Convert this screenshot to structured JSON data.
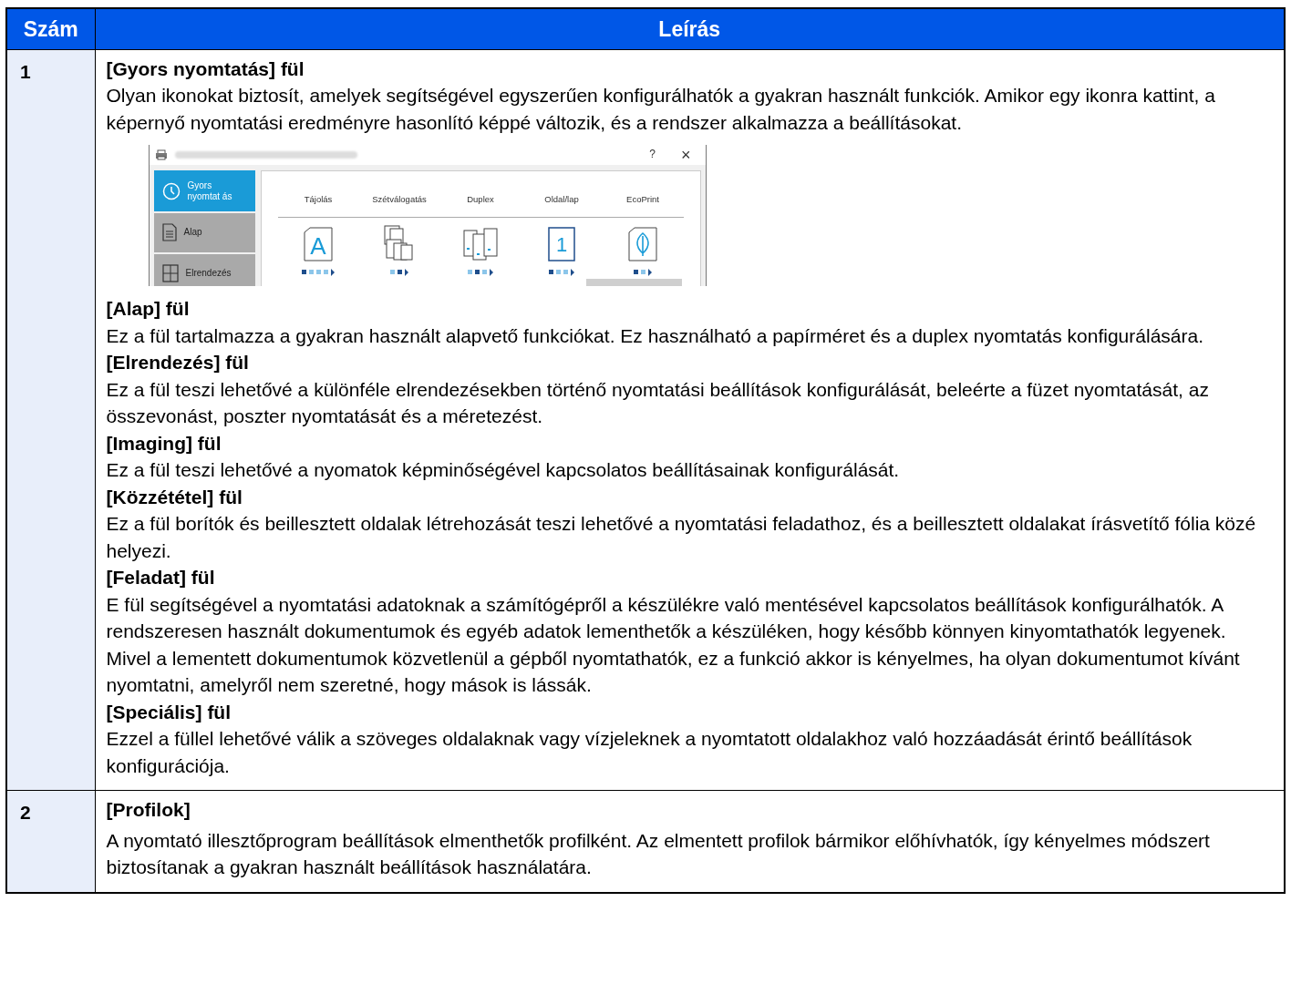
{
  "table": {
    "columns": [
      "Szám",
      "Leírás"
    ],
    "rows": [
      {
        "number": "1",
        "sections": [
          {
            "heading": "[Gyors nyomtatás] fül",
            "body": "Olyan ikonokat biztosít, amelyek segítségével egyszerűen konfigurálhatók a gyakran használt funkciók. Amikor egy ikonra kattint, a képernyő nyomtatási eredményre hasonlító képpé változik, és a rendszer alkalmazza a beállításokat.",
            "screenshot": {
              "help": "?",
              "close": "×",
              "tabs": [
                {
                  "label": "Gyors nyomtat ás",
                  "kind": "clock",
                  "selected": true
                },
                {
                  "label": "Alap",
                  "kind": "doc",
                  "selected": false
                },
                {
                  "label": "Elrendezés",
                  "kind": "grid",
                  "selected": false
                }
              ],
              "options": [
                {
                  "label": "Tájolás",
                  "kind": "letter",
                  "glyph": "A",
                  "dots": [
                    {
                      "selected": true
                    },
                    {
                      "selected": false
                    },
                    {
                      "selected": false
                    },
                    {
                      "selected": false
                    }
                  ]
                },
                {
                  "label": "Szétválogatás",
                  "kind": "collate",
                  "dots": [
                    {
                      "selected": false
                    },
                    {
                      "selected": true
                    }
                  ]
                },
                {
                  "label": "Duplex",
                  "kind": "duplex",
                  "dots": [
                    {
                      "selected": false
                    },
                    {
                      "selected": true
                    },
                    {
                      "selected": false
                    }
                  ]
                },
                {
                  "label": "Oldal/lap",
                  "kind": "page",
                  "glyph": "1",
                  "dots": [
                    {
                      "selected": true
                    },
                    {
                      "selected": false
                    },
                    {
                      "selected": false
                    }
                  ]
                },
                {
                  "label": "EcoPrint",
                  "kind": "leaf",
                  "dots": [
                    {
                      "selected": true
                    },
                    {
                      "selected": false
                    }
                  ]
                }
              ]
            }
          },
          {
            "heading": "[Alap] fül",
            "body": "Ez a fül tartalmazza a gyakran használt alapvető funkciókat. Ez használható a papírméret és a duplex nyomtatás konfigurálására."
          },
          {
            "heading": "[Elrendezés] fül",
            "body": "Ez a fül teszi lehetővé a különféle elrendezésekben történő nyomtatási beállítások konfigurálását, beleérte a füzet nyomtatását, az összevonást, poszter nyomtatását és a méretezést."
          },
          {
            "heading": "[Imaging] fül",
            "body": "Ez a fül teszi lehetővé a nyomatok képminőségével kapcsolatos beállításainak konfigurálását."
          },
          {
            "heading": "[Közzététel] fül",
            "body": "Ez a fül borítók és beillesztett oldalak létrehozását teszi lehetővé a nyomtatási feladathoz, és a beillesztett oldalakat írásvetítő fólia közé helyezi."
          },
          {
            "heading": "[Feladat] fül",
            "body": "E fül segítségével a nyomtatási adatoknak a számítógépről a készülékre való mentésével kapcsolatos beállítások konfigurálhatók. A rendszeresen használt dokumentumok és egyéb adatok lementhetők a készüléken, hogy később könnyen kinyomtathatók legyenek. Mivel a lementett dokumentumok közvetlenül a gépből nyomtathatók, ez a funkció akkor is kényelmes, ha olyan dokumentumot kívánt nyomtatni, amelyről nem szeretné, hogy mások is lássák."
          },
          {
            "heading": "[Speciális] fül",
            "body": "Ezzel a füllel lehetővé válik a szöveges oldalaknak vagy vízjeleknek a nyomtatott oldalakhoz való hozzáadását érintő beállítások konfigurációja."
          }
        ]
      },
      {
        "number": "2",
        "sections": [
          {
            "heading": "[Profilok]",
            "body": "A nyomtató illesztőprogram beállítások elmenthetők profilként. Az elmentett profilok bármikor előhívhatók, így kényelmes módszert biztosítanak a gyakran használt beállítások használatára."
          }
        ]
      }
    ]
  }
}
